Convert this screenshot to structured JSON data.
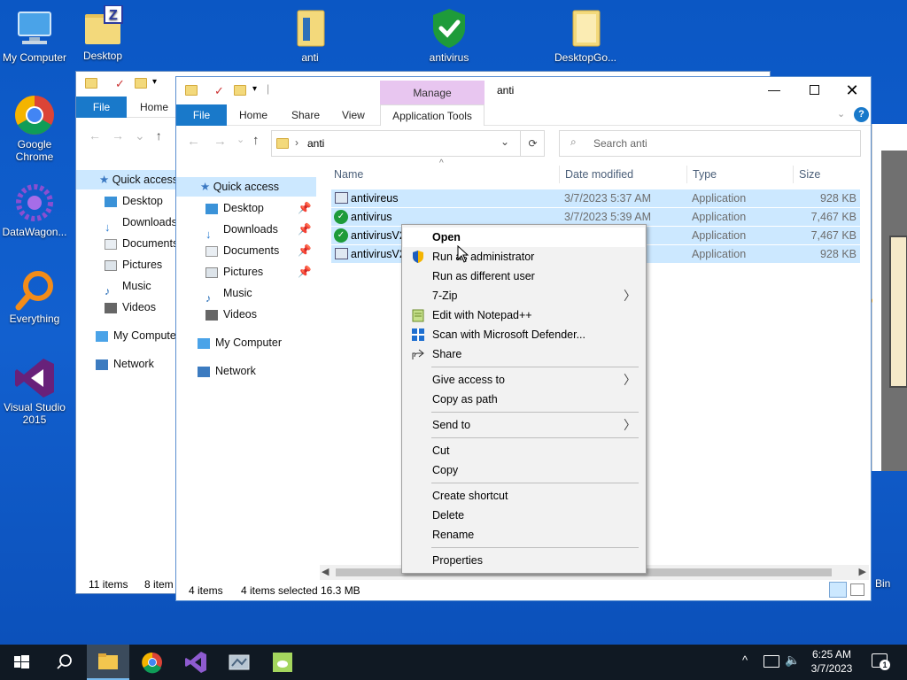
{
  "desktop": {
    "icons": [
      {
        "label": "My Computer"
      },
      {
        "label": "Desktop"
      },
      {
        "label": "anti"
      },
      {
        "label": "antivirus"
      },
      {
        "label": "DesktopGo..."
      },
      {
        "label": "Google Chrome"
      },
      {
        "label": "DataWagon..."
      },
      {
        "label": "Everything"
      },
      {
        "label": "Visual Studio 2015"
      },
      {
        "label": "Bin"
      }
    ]
  },
  "back_window": {
    "tabs": {
      "file": "File",
      "home": "Home"
    },
    "nav": [
      "Quick access",
      "Desktop",
      "Downloads",
      "Documents",
      "Pictures",
      "Music",
      "Videos",
      "My Compute",
      "Network"
    ],
    "status_items": "11 items",
    "status_selected": "8 item"
  },
  "window": {
    "title": "anti",
    "manage_label": "Manage",
    "tabs": {
      "file": "File",
      "home": "Home",
      "share": "Share",
      "view": "View",
      "app_tools": "Application Tools"
    },
    "address": {
      "path": "anti"
    },
    "search": {
      "placeholder": "Search anti"
    },
    "nav": {
      "quick_access": "Quick access",
      "items": [
        "Desktop",
        "Downloads",
        "Documents",
        "Pictures",
        "Music",
        "Videos"
      ],
      "my_computer": "My Computer",
      "network": "Network"
    },
    "columns": {
      "name": "Name",
      "date": "Date modified",
      "type": "Type",
      "size": "Size"
    },
    "files": [
      {
        "name": "antivireus",
        "date": "3/7/2023 5:37 AM",
        "type": "Application",
        "size": "928 KB"
      },
      {
        "name": "antivirus",
        "date": "3/7/2023 5:39 AM",
        "type": "Application",
        "size": "7,467 KB"
      },
      {
        "name": "antivirusV2",
        "date": "",
        "type": "Application",
        "size": "7,467 KB"
      },
      {
        "name": "antivirusV2",
        "date": "",
        "type": "Application",
        "size": "928 KB"
      }
    ],
    "status": {
      "items": "4 items",
      "selected": "4 items selected",
      "size": "16.3 MB"
    }
  },
  "context_menu": {
    "items": [
      "Open",
      "Run as administrator",
      "Run as different user",
      "7-Zip",
      "Edit with Notepad++",
      "Scan with Microsoft Defender...",
      "Share",
      "Give access to",
      "Copy as path",
      "Send to",
      "Cut",
      "Copy",
      "Create shortcut",
      "Delete",
      "Rename",
      "Properties"
    ]
  },
  "taskbar": {
    "time": "6:25 AM",
    "date": "3/7/2023",
    "notification_count": "1"
  },
  "colors": {
    "accent": "#1979ca",
    "selection": "#cce8ff",
    "manage": "#e8c6f0",
    "taskbar": "#101923"
  }
}
